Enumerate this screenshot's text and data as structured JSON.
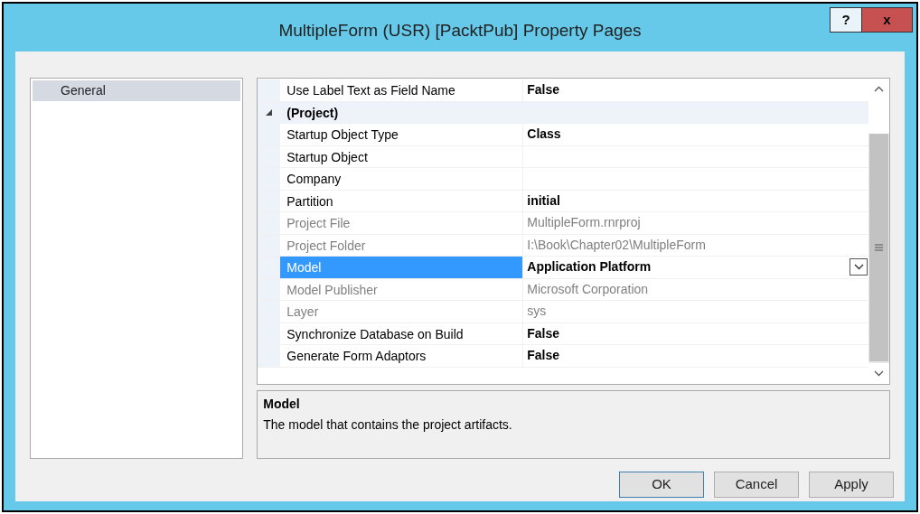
{
  "window": {
    "title": "MultipleForm (USR) [PacktPub] Property Pages",
    "help_button": "?",
    "close_button": "x"
  },
  "sidebar": {
    "items": [
      {
        "label": "General",
        "selected": true
      }
    ]
  },
  "properties": [
    {
      "kind": "property",
      "name": "Use Label Text as Field Name",
      "value": "False",
      "bold": true,
      "readonly": false,
      "selected": false
    },
    {
      "kind": "category",
      "name": "(Project)",
      "expanded": true
    },
    {
      "kind": "property",
      "name": "Startup Object Type",
      "value": "Class",
      "bold": true,
      "readonly": false,
      "selected": false
    },
    {
      "kind": "property",
      "name": "Startup Object",
      "readonly": false,
      "selected": false
    },
    {
      "kind": "property",
      "name": "Company",
      "readonly": false,
      "selected": false
    },
    {
      "kind": "property",
      "name": "Partition",
      "value": "initial",
      "bold": true,
      "readonly": false,
      "selected": false
    },
    {
      "kind": "property",
      "name": "Project File",
      "value": "MultipleForm.rnrproj",
      "bold": false,
      "readonly": true,
      "selected": false
    },
    {
      "kind": "property",
      "name": "Project Folder",
      "value": "I:\\Book\\Chapter02\\MultipleForm",
      "bold": false,
      "readonly": true,
      "selected": false
    },
    {
      "kind": "property",
      "name": "Model",
      "value": "Application Platform",
      "bold": true,
      "readonly": false,
      "selected": true
    },
    {
      "kind": "property",
      "name": "Model Publisher",
      "value": "Microsoft Corporation",
      "bold": false,
      "readonly": true,
      "selected": false
    },
    {
      "kind": "property",
      "name": "Layer",
      "value": "sys",
      "bold": false,
      "readonly": true,
      "selected": false
    },
    {
      "kind": "property",
      "name": "Synchronize Database on Build",
      "value": "False",
      "bold": true,
      "readonly": false,
      "selected": false
    },
    {
      "kind": "property",
      "name": "Generate Form Adaptors",
      "value": "False",
      "bold": true,
      "readonly": false,
      "selected": false
    }
  ],
  "description": {
    "title": "Model",
    "text": "The model that contains the project artifacts."
  },
  "buttons": [
    {
      "label": "OK",
      "default": true
    },
    {
      "label": "Cancel",
      "default": false
    },
    {
      "label": "Apply",
      "default": false
    }
  ]
}
